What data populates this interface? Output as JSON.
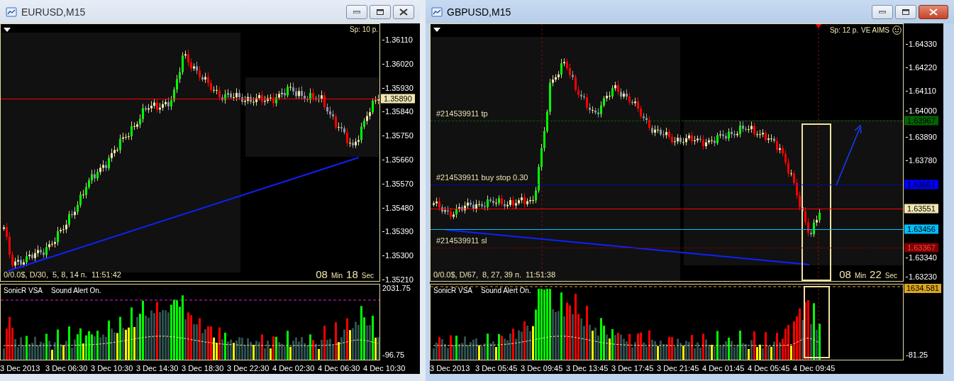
{
  "windows": [
    {
      "title": "EURUSD,M15",
      "active": false,
      "spread": "Sp: 10 p.",
      "price_ticks": [
        "1.36110",
        "1.36020",
        "1.35930",
        "1.35840",
        "1.35750",
        "1.35660",
        "1.35570",
        "1.35480",
        "1.35390",
        "1.35300",
        "1.35210"
      ],
      "levels": [
        {
          "kind": "bid",
          "value": "1.35890"
        }
      ],
      "status": "0/0.0$, D/30,  5, 8, 14 п.  11:51:42",
      "timer": {
        "minutes": "08",
        "min_unit": "Min",
        "seconds": "18",
        "sec_unit": "Sec"
      },
      "indicator": {
        "name": "SonicR VSA",
        "alert": "Sound Alert On.",
        "top_tick": "2031.75",
        "bottom_tick": "-96.75"
      },
      "time_labels": [
        "3 Dec 2013",
        "3 Dec 06:30",
        "3 Dec 10:30",
        "3 Dec 14:30",
        "3 Dec 18:30",
        "3 Dec 22:30",
        "4 Dec 02:30",
        "4 Dec 06:30",
        "4 Dec 10:30"
      ]
    },
    {
      "title": "GBPUSD,M15",
      "active": true,
      "spread": "Sp: 12 p.",
      "badge_text": "VE AIMS",
      "price_ticks": [
        "1.64330",
        "1.64220",
        "1.64110",
        "1.64000",
        "1.63890",
        "1.63780",
        "1.63340",
        "1.63230"
      ],
      "levels": [
        {
          "kind": "level",
          "value": "1.63967",
          "color": "#006400",
          "dashed": true,
          "label": "#214539911 tp"
        },
        {
          "kind": "level",
          "value": "1.63667",
          "color": "#0000ff",
          "dashed": true,
          "label": "#214539911 buy stop 0.30"
        },
        {
          "kind": "bid",
          "value": "1.63551"
        },
        {
          "kind": "level",
          "value": "1.63456",
          "color": "#00bfff",
          "dashed": false
        },
        {
          "kind": "level",
          "value": "1.63367",
          "color": "#800000",
          "dashed": true,
          "label": "#214539911 sl"
        }
      ],
      "status": "0/0.0$, D/67,  8, 27, 39 п.  11:51:38",
      "timer": {
        "minutes": "08",
        "min_unit": "Min",
        "seconds": "22",
        "sec_unit": "Sec"
      },
      "indicator": {
        "name": "SonicR VSA",
        "alert": "Sound Alert On.",
        "level_badge": {
          "value": "1634.581",
          "color": "#daa520"
        },
        "bottom_tick": "-81.25"
      },
      "time_labels": [
        "3 Dec 2013",
        "3 Dec 05:45",
        "3 Dec 09:45",
        "3 Dec 13:45",
        "3 Dec 17:45",
        "3 Dec 21:45",
        "4 Dec 01:45",
        "4 Dec 05:45",
        "4 Dec 09:45"
      ]
    }
  ]
}
